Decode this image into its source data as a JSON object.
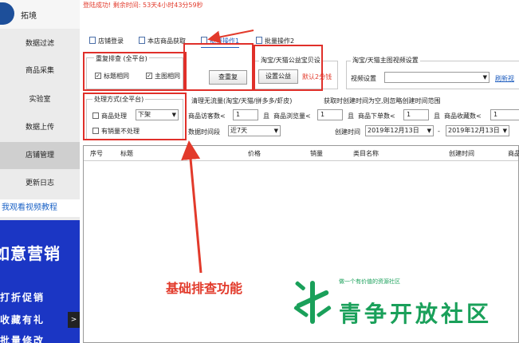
{
  "app": {
    "logo_text": "拓境"
  },
  "status": {
    "login_message": "登陆成功! 剩余时间: 53天4小时43分59秒"
  },
  "sidebar": {
    "items": [
      {
        "label": "数据过滤"
      },
      {
        "label": "商品采集"
      },
      {
        "label": "实验室"
      },
      {
        "label": "数据上传"
      },
      {
        "label": "店铺管理",
        "active": true
      },
      {
        "label": "更新日志"
      }
    ],
    "video_link": "我观看视频教程",
    "promo": {
      "title": "如意营销",
      "lines": [
        "打折促销",
        "收藏有礼",
        "批量修改"
      ],
      "arrow": ">"
    }
  },
  "tabs": [
    {
      "label": "店铺登录"
    },
    {
      "label": "本店商品获取"
    },
    {
      "label": "批量操作1",
      "active": true
    },
    {
      "label": "批量操作2"
    }
  ],
  "dup_check": {
    "title": "重复排查 (全平台)",
    "title_same": "标题相同",
    "image_same": "主图相同",
    "button": "查重复"
  },
  "charity": {
    "title": "淘宝/天猫公益宝贝设",
    "button": "设置公益",
    "default_note": "默认2分钱"
  },
  "video_settings": {
    "title": "淘宝/天猫主图视频设置",
    "label": "视频设置",
    "select_value": "",
    "refresh_link": "刷新视"
  },
  "process": {
    "title": "处理方式(全平台)",
    "product_process": "商品处理",
    "process_select": "下架",
    "sales_skip": "有销量不处理"
  },
  "clean_traffic": {
    "title": "清理无流量(淘宝/天猫/拼多多/虾皮)",
    "visitors_label": "商品访客数<",
    "visitors_value": "1",
    "and1": "且",
    "views_label": "商品浏览量<",
    "views_value": "1",
    "and2": "且",
    "orders_label": "商品下单数<",
    "orders_value": "1",
    "and3": "且",
    "favorites_label": "商品收藏数<",
    "favorites_value": "1",
    "period_label": "数据时间段",
    "period_value": "近7天"
  },
  "created_time": {
    "title": "获取时创建时间为空,则忽略创建时间范围",
    "label": "创建时间",
    "start": "2019年12月13日",
    "sep": "-",
    "end": "2019年12月13日"
  },
  "table": {
    "columns": [
      "序号",
      "标题",
      "价格",
      "销量",
      "类目名称",
      "创建时间",
      "商品"
    ]
  },
  "annotation": {
    "caption": "基础排查功能"
  },
  "watermark": {
    "small": "做一个有价值的资源社区",
    "big": "青争开放社区"
  },
  "colors": {
    "accent_red": "#e23a2b",
    "link_blue": "#1f5ebf",
    "promo_blue": "#1b36c4",
    "watermark_green": "#1aa05a"
  }
}
